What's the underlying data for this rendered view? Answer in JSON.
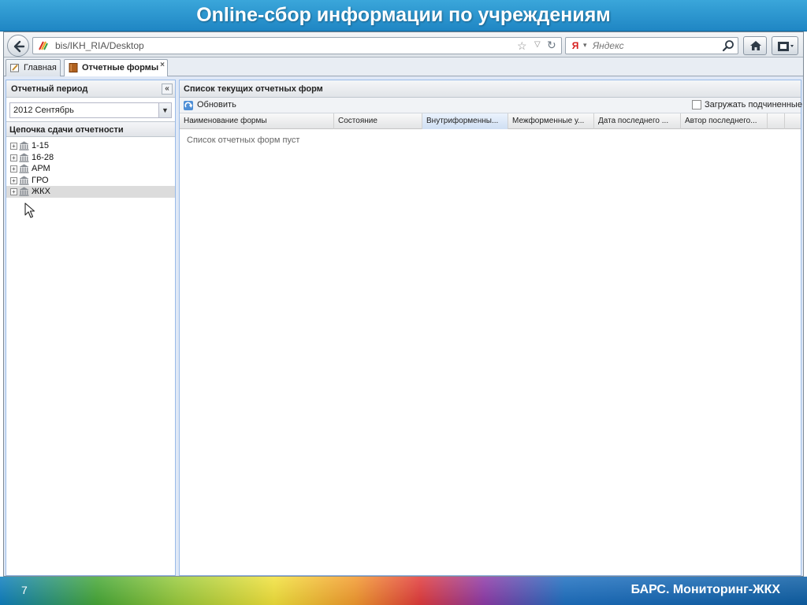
{
  "slide": {
    "title": "Online-сбор информации по учреждениям",
    "page_number": "7",
    "brand": "БАРС. Мониторинг-ЖКХ"
  },
  "browser": {
    "url": "bis/IKH_RIA/Desktop",
    "search_placeholder": "Яндекс",
    "search_engine_icon": "yandex-icon"
  },
  "app": {
    "tabs": [
      {
        "label": "Главная",
        "icon": "edit-icon",
        "active": false
      },
      {
        "label": "Отчетные формы",
        "icon": "book-icon",
        "active": true,
        "close": "×"
      }
    ],
    "left_panel": {
      "period_header": "Отчетный период",
      "period_value": "2012 Сентябрь",
      "chain_header": "Цепочка сдачи отчетности",
      "tree": [
        {
          "label": "1-15",
          "icon": "building-icon"
        },
        {
          "label": "16-28",
          "icon": "building-icon"
        },
        {
          "label": "АРМ",
          "icon": "building-icon"
        },
        {
          "label": "ГРО",
          "icon": "building-icon"
        },
        {
          "label": "ЖКХ",
          "icon": "building-icon",
          "selected": true
        }
      ]
    },
    "right_panel": {
      "header": "Список текущих отчетных форм",
      "refresh_label": "Обновить",
      "load_subordinates_label": "Загружать подчиненные",
      "columns": [
        "Наименование формы",
        "Состояние",
        "Внутриформенны...",
        "Межформенные у...",
        "Дата последнего ...",
        "Автор последнего..."
      ],
      "empty_text": "Список отчетных форм пуст"
    }
  },
  "colors": {
    "header_blue": "#1f86c4",
    "panel_border": "#99bbe8"
  }
}
